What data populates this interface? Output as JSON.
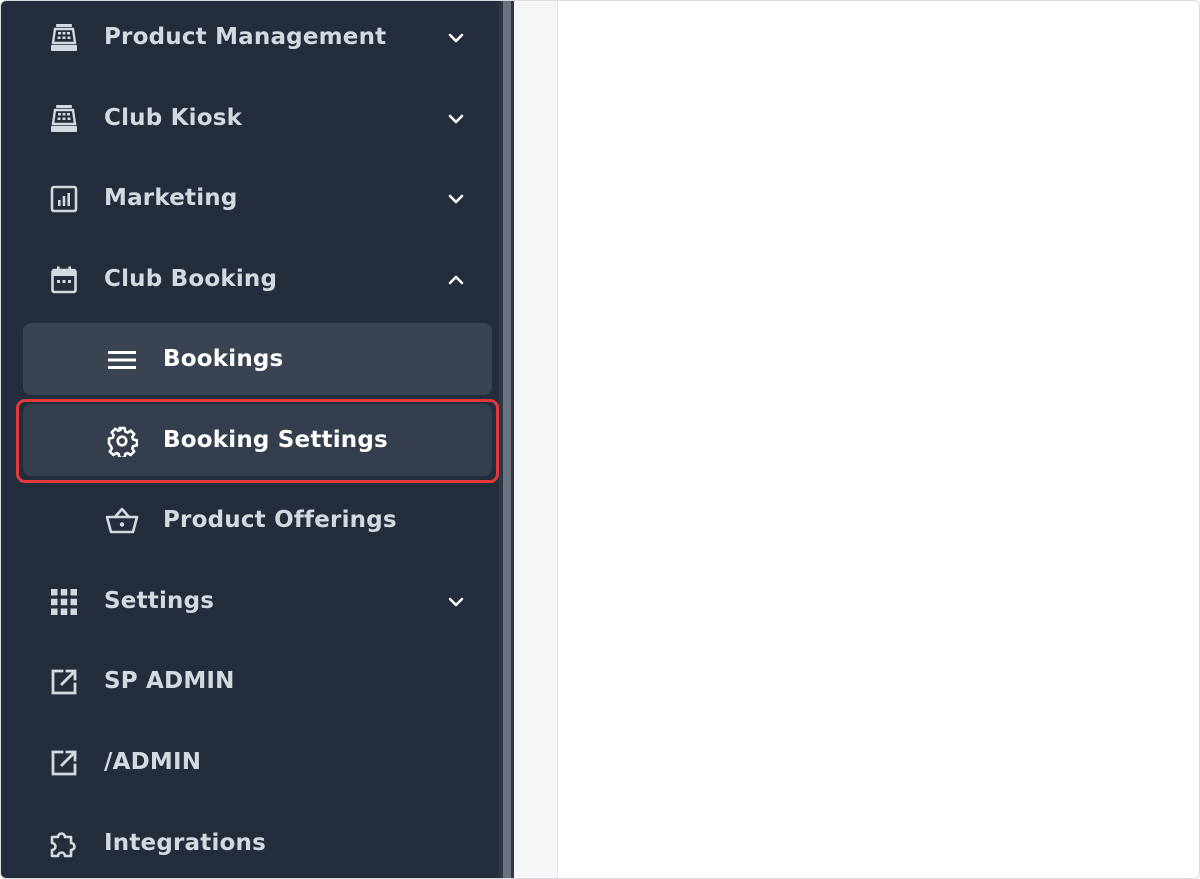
{
  "sidebar": {
    "items": [
      {
        "label": "Product Management",
        "icon": "cash-register-icon",
        "chevron": "down"
      },
      {
        "label": "Club Kiosk",
        "icon": "cash-register-icon",
        "chevron": "down"
      },
      {
        "label": "Marketing",
        "icon": "chart-box-icon",
        "chevron": "down"
      },
      {
        "label": "Club Booking",
        "icon": "calendar-icon",
        "chevron": "up"
      },
      {
        "label": "Bookings",
        "icon": "menu-lines-icon",
        "sub": true
      },
      {
        "label": "Booking Settings",
        "icon": "gear-icon",
        "sub": true
      },
      {
        "label": "Product Offerings",
        "icon": "basket-icon",
        "sub": true
      },
      {
        "label": "Settings",
        "icon": "grid-icon",
        "chevron": "down"
      },
      {
        "label": "SP ADMIN",
        "icon": "external-link-icon"
      },
      {
        "label": "/ADMIN",
        "icon": "external-link-icon"
      },
      {
        "label": "Integrations",
        "icon": "puzzle-icon"
      }
    ]
  },
  "colors": {
    "sidebar_bg": "#242d3c",
    "active_bg": "#3a4352",
    "highlight": "#e5383b",
    "text": "#d4d8df"
  }
}
